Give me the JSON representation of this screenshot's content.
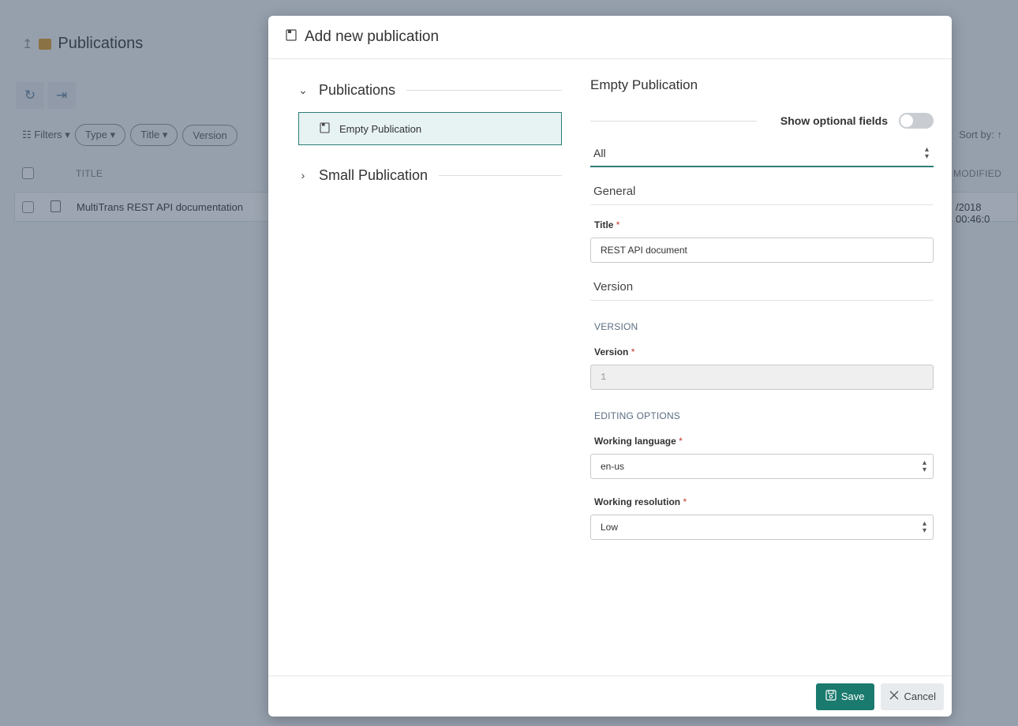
{
  "background": {
    "title": "Publications",
    "filters_label": "Filters",
    "filter_chips": [
      "Type",
      "Title",
      "Version"
    ],
    "sort_label": "Sort by:",
    "columns": {
      "title": "TITLE",
      "modified": "MODIFIED"
    },
    "row": {
      "title": "MultiTrans REST API documentation",
      "modified": "/2018 00:46:0"
    }
  },
  "dialog": {
    "title": "Add new publication",
    "tree": {
      "groups": [
        {
          "label": "Publications",
          "expanded": true,
          "items": [
            "Empty Publication"
          ]
        },
        {
          "label": "Small Publication",
          "expanded": false
        }
      ],
      "selected": "Empty Publication"
    },
    "form": {
      "heading": "Empty Publication",
      "show_optional_label": "Show optional fields",
      "show_optional_on": false,
      "filter_value": "All",
      "sections": {
        "general": "General",
        "version": "Version"
      },
      "fields": {
        "title_label": "Title",
        "title_value": "REST API document",
        "version_caption": "VERSION",
        "version_label": "Version",
        "version_value": "1",
        "editing_caption": "EDITING OPTIONS",
        "language_label": "Working language",
        "language_value": "en-us",
        "resolution_label": "Working resolution",
        "resolution_value": "Low"
      },
      "required_mark": "*"
    },
    "footer": {
      "save_label": "Save",
      "cancel_label": "Cancel"
    }
  },
  "colors": {
    "accent": "#1a7a6e",
    "selected_bg": "#e7f2f2",
    "required": "#c0392b"
  }
}
